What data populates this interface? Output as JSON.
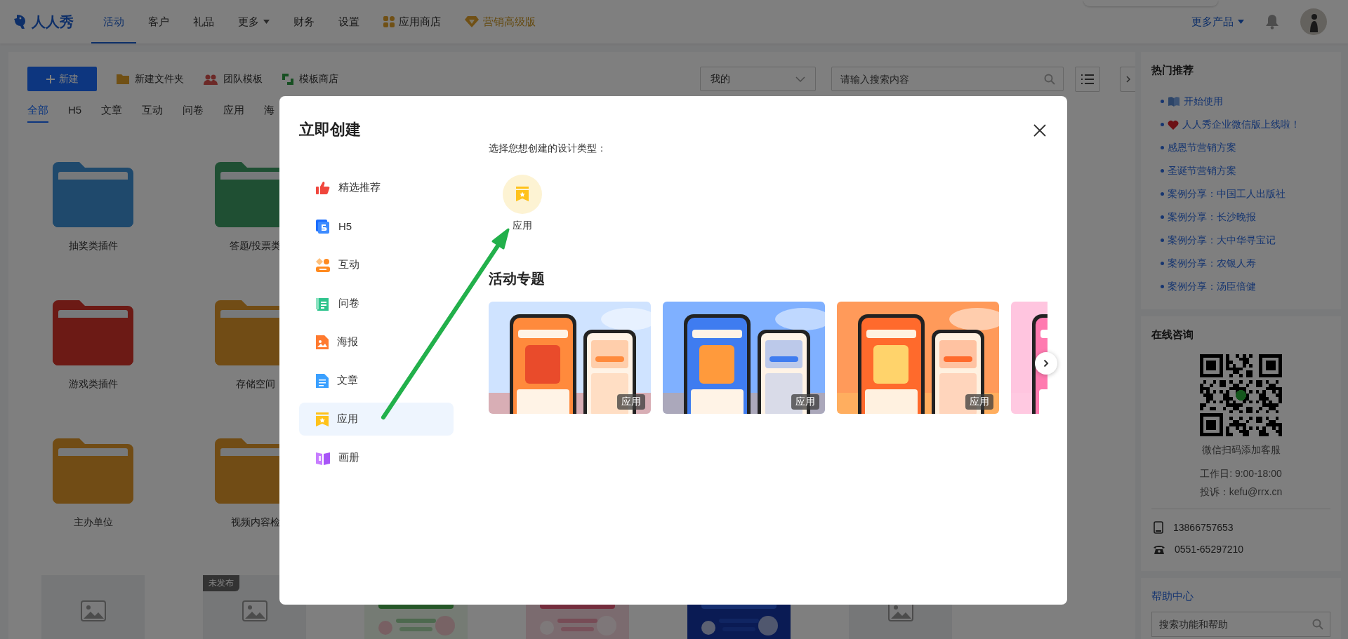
{
  "nav": {
    "logo": "人人秀",
    "items": [
      {
        "label": "活动",
        "selected": true,
        "kind": "plain"
      },
      {
        "label": "客户",
        "selected": false,
        "kind": "plain"
      },
      {
        "label": "礼品",
        "selected": false,
        "kind": "plain"
      },
      {
        "label": "更多",
        "selected": false,
        "kind": "dropdown"
      },
      {
        "label": "财务",
        "selected": false,
        "kind": "plain"
      },
      {
        "label": "设置",
        "selected": false,
        "kind": "plain"
      },
      {
        "label": "应用商店",
        "selected": false,
        "kind": "store"
      },
      {
        "label": "营销高级版",
        "selected": false,
        "kind": "premium"
      }
    ],
    "more_products": "更多产品"
  },
  "toolbar": {
    "new_button": "新建",
    "actions": [
      {
        "label": "新建文件夹",
        "kind": "folder"
      },
      {
        "label": "团队模板",
        "kind": "team"
      },
      {
        "label": "模板商店",
        "kind": "store"
      }
    ],
    "scope": "我的",
    "search_placeholder": "请输入搜索内容"
  },
  "filter_tabs": [
    {
      "label": "全部",
      "selected": true
    },
    {
      "label": "H5",
      "selected": false
    },
    {
      "label": "文章",
      "selected": false
    },
    {
      "label": "互动",
      "selected": false
    },
    {
      "label": "问卷",
      "selected": false
    },
    {
      "label": "应用",
      "selected": false
    },
    {
      "label": "海",
      "selected": false
    }
  ],
  "folders": [
    {
      "name": "抽奖类插件"
    },
    {
      "name": "答题/投票类"
    },
    {
      "name": "游戏类插件"
    },
    {
      "name": "存储空间"
    },
    {
      "name": "主办单位"
    },
    {
      "name": "视频内容检"
    }
  ],
  "thumbnails": [
    {
      "kind": "placeholder"
    },
    {
      "kind": "placeholder",
      "badge": "未发布"
    },
    {
      "kind": "picture"
    },
    {
      "kind": "picture"
    },
    {
      "kind": "picture"
    },
    {
      "kind": "placeholder"
    }
  ],
  "sidebar": {
    "hot": {
      "title": "热门推荐",
      "links": [
        {
          "text": "开始使用",
          "kind": "book"
        },
        {
          "text": "人人秀企业微信版上线啦！",
          "kind": "heart"
        },
        {
          "text": "感恩节营销方案"
        },
        {
          "text": "圣诞节营销方案"
        },
        {
          "text": "案例分享：中国工人出版社"
        },
        {
          "text": "案例分享：长沙晚报"
        },
        {
          "text": "案例分享：大中华寻宝记"
        },
        {
          "text": "案例分享：农银人寿"
        },
        {
          "text": "案例分享：汤臣倍健"
        }
      ]
    },
    "consult": {
      "title": "在线咨询",
      "qr_caption": "微信扫码添加客服",
      "hours": "工作日: 9:00-18:00",
      "complaint": "投诉：kefu@rrx.cn",
      "contacts": [
        {
          "kind": "mobile",
          "text": "13866757653"
        },
        {
          "kind": "phone",
          "text": "0551-65297210"
        }
      ]
    },
    "help": {
      "title": "帮助中心",
      "search_placeholder": "搜索功能和帮助"
    }
  },
  "modal": {
    "title": "立即创建",
    "menu": [
      {
        "label": "精选推荐",
        "kind": "featured",
        "selected": false
      },
      {
        "label": "H5",
        "kind": "h5",
        "selected": false
      },
      {
        "label": "互动",
        "kind": "interactive",
        "selected": false
      },
      {
        "label": "问卷",
        "kind": "survey",
        "selected": false
      },
      {
        "label": "海报",
        "kind": "poster",
        "selected": false
      },
      {
        "label": "文章",
        "kind": "article",
        "selected": false
      },
      {
        "label": "应用",
        "kind": "app",
        "selected": true
      },
      {
        "label": "画册",
        "kind": "album",
        "selected": false
      }
    ],
    "prompt": "选择您想创建的设计类型：",
    "types": [
      {
        "label": "应用",
        "kind": "app"
      }
    ],
    "section_title": "活动专题",
    "cards": [
      {
        "kind": "picture",
        "tag": "应用"
      },
      {
        "kind": "picture",
        "tag": "应用"
      },
      {
        "kind": "picture",
        "tag": "应用"
      },
      {
        "kind": "picture"
      }
    ]
  }
}
